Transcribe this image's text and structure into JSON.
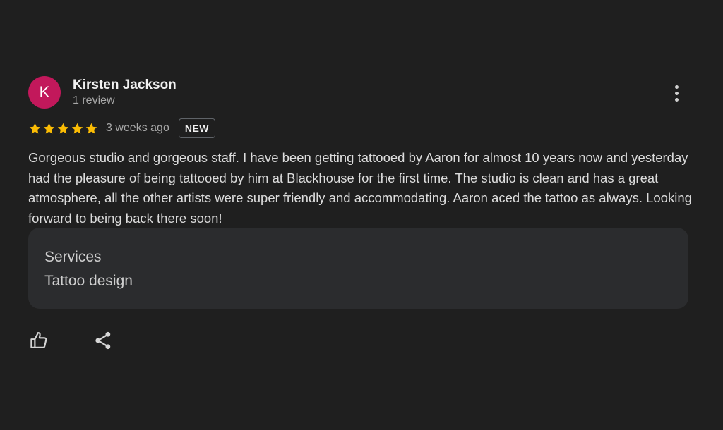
{
  "review": {
    "author": {
      "initial": "K",
      "name": "Kirsten Jackson",
      "review_count": "1 review",
      "avatar_color": "#c2185b"
    },
    "rating": 5,
    "star_color": "#fbbc04",
    "time_ago": "3 weeks ago",
    "badge": "NEW",
    "text": "Gorgeous studio and gorgeous staff. I have been getting tattooed by Aaron for almost 10 years now and yesterday had the pleasure of being tattooed by him at Blackhouse for the first time. The studio is clean and has a great atmosphere, all the other artists were super friendly and accommodating. Aaron aced the tattoo as always. Looking forward to being back there soon!",
    "services": {
      "title": "Services",
      "value": "Tattoo design"
    }
  },
  "icons": {
    "more": "more-vert-icon",
    "like": "thumb-up-icon",
    "share": "share-icon",
    "star": "star-icon"
  },
  "theme": {
    "background": "#1f1f1f",
    "card": "#2b2c2e"
  }
}
